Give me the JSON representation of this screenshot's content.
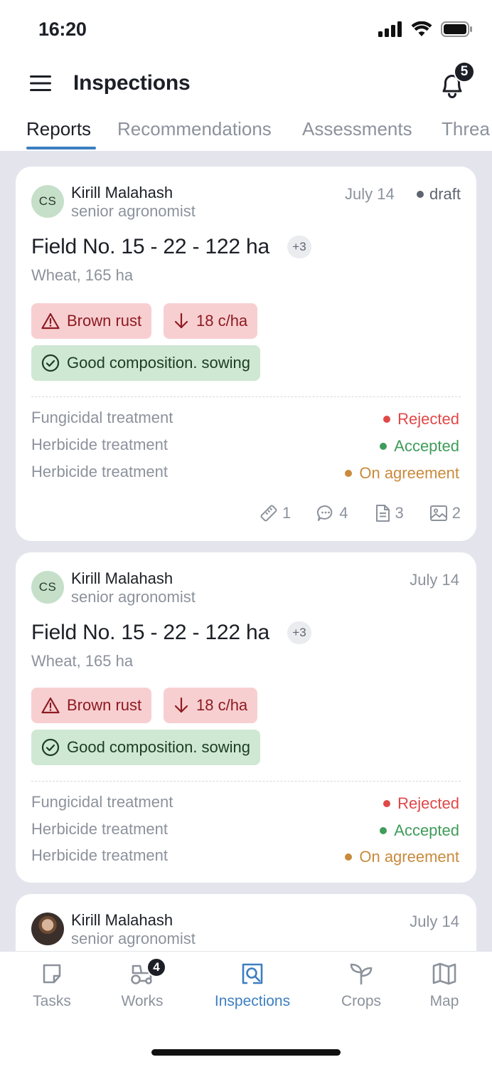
{
  "status_bar": {
    "time": "16:20"
  },
  "header": {
    "title": "Inspections",
    "notification_count": "5"
  },
  "tabs": [
    {
      "label": "Reports",
      "active": true
    },
    {
      "label": "Recommendations",
      "active": false
    },
    {
      "label": "Assessments",
      "active": false
    },
    {
      "label": "Threa",
      "active": false
    }
  ],
  "cards": [
    {
      "initials": "CS",
      "author": "Kirill Malahash",
      "role": "senior agronomist",
      "date": "July 14",
      "status": "draft",
      "field": "Field No. 15 - 22 - 122 ha",
      "more": "+3",
      "crop": "Wheat, 165 ha",
      "chips": {
        "disease": "Brown rust",
        "yield": "18 c/ha",
        "good": "Good composition. sowing"
      },
      "treatments": [
        {
          "label": "Fungicidal treatment",
          "status": "Rejected",
          "color": "#e04848"
        },
        {
          "label": "Herbicide treatment",
          "status": "Accepted",
          "color": "#3f9c5a"
        },
        {
          "label": "Herbicide treatment",
          "status": "On agreement",
          "color": "#c98a3c"
        }
      ],
      "counts": {
        "measures": "1",
        "comments": "4",
        "documents": "3",
        "images": "2"
      }
    },
    {
      "initials": "CS",
      "author": "Kirill Malahash",
      "role": "senior agronomist",
      "date": "July 14",
      "field": "Field No. 15 - 22 - 122 ha",
      "more": "+3",
      "crop": "Wheat, 165 ha",
      "chips": {
        "disease": "Brown rust",
        "yield": "18 c/ha",
        "good": "Good composition. sowing"
      },
      "treatments": [
        {
          "label": "Fungicidal treatment",
          "status": "Rejected",
          "color": "#e04848"
        },
        {
          "label": "Herbicide treatment",
          "status": "Accepted",
          "color": "#3f9c5a"
        },
        {
          "label": "Herbicide treatment",
          "status": "On agreement",
          "color": "#c98a3c"
        }
      ]
    },
    {
      "author": "Kirill Malahash",
      "role": "senior agronomist",
      "date": "July 14"
    }
  ],
  "bottom_nav": [
    {
      "label": "Tasks",
      "icon": "tasks-icon"
    },
    {
      "label": "Works",
      "icon": "tractor-icon",
      "badge": "4"
    },
    {
      "label": "Inspections",
      "icon": "inspection-search-icon",
      "active": true
    },
    {
      "label": "Crops",
      "icon": "sprout-icon"
    },
    {
      "label": "Map",
      "icon": "map-icon"
    }
  ],
  "colors": {
    "accent": "#3d7fc0",
    "rejected": "#e04848",
    "accepted": "#3f9c5a",
    "on_agreement": "#c98a3c"
  }
}
